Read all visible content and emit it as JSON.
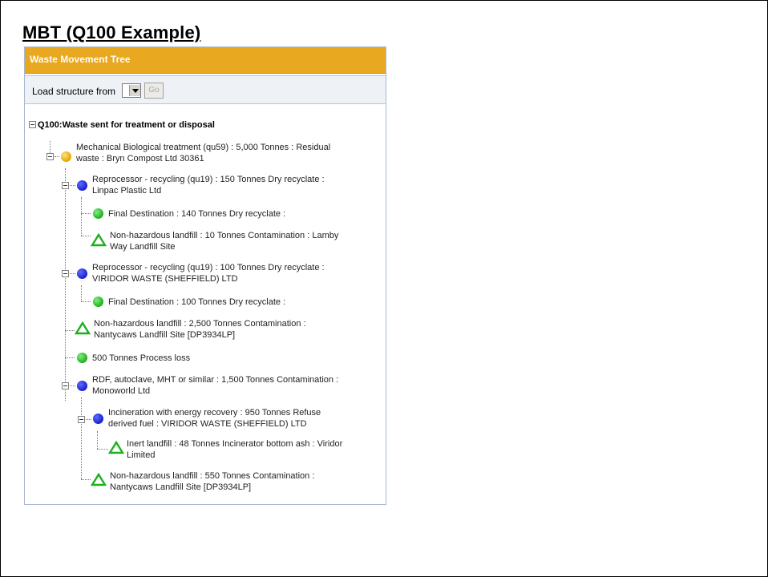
{
  "page": {
    "title": "MBT (Q100 Example)"
  },
  "panel": {
    "header": "Waste Movement Tree",
    "toolbar": {
      "load_label": "Load structure from",
      "go_label": "Go"
    }
  },
  "tree": {
    "root": "Q100:Waste sent for treatment or disposal",
    "nodes": [
      {
        "icon": "orange-circle",
        "line1": "Mechanical Biological treatment (qu59) : 5,000 Tonnes : Residual",
        "line2": "waste : Bryn Compost Ltd 30361"
      },
      {
        "icon": "blue-circle",
        "line1": "Reprocessor - recycling (qu19) : 150 Tonnes Dry recyclate :",
        "line2": "Linpac Plastic Ltd"
      },
      {
        "icon": "green-circle",
        "line1": "Final Destination : 140 Tonnes Dry recyclate :",
        "line2": ""
      },
      {
        "icon": "green-triangle",
        "line1": "Non-hazardous landfill : 10 Tonnes Contamination : Lamby",
        "line2": "Way Landfill Site"
      },
      {
        "icon": "blue-circle",
        "line1": "Reprocessor - recycling (qu19) : 100 Tonnes Dry recyclate :",
        "line2": "VIRIDOR WASTE (SHEFFIELD) LTD"
      },
      {
        "icon": "green-circle",
        "line1": "Final Destination : 100 Tonnes Dry recyclate :",
        "line2": ""
      },
      {
        "icon": "green-triangle",
        "line1": "Non-hazardous landfill : 2,500 Tonnes Contamination :",
        "line2": "Nantycaws Landfill Site [DP3934LP]"
      },
      {
        "icon": "green-circle",
        "line1": "500 Tonnes Process loss",
        "line2": ""
      },
      {
        "icon": "blue-circle",
        "line1": "RDF, autoclave, MHT or similar : 1,500 Tonnes Contamination :",
        "line2": "Monoworld Ltd"
      },
      {
        "icon": "blue-circle",
        "line1": "Incineration with energy recovery : 950 Tonnes Refuse",
        "line2": "derived fuel : VIRIDOR WASTE (SHEFFIELD) LTD"
      },
      {
        "icon": "green-triangle",
        "line1": "Inert landfill : 48 Tonnes Incinerator bottom ash : Viridor",
        "line2": "Limited"
      },
      {
        "icon": "green-triangle",
        "line1": "Non-hazardous landfill : 550 Tonnes Contamination :",
        "line2": "Nantycaws Landfill Site [DP3934LP]"
      }
    ]
  },
  "colors": {
    "header_bg": "#e8a820",
    "panel_border": "#a9b8d0",
    "toolbar_bg": "#eef1f6",
    "orange_node": "#e2a400",
    "blue_node": "#1a1fcf",
    "green_node": "#1fae1f"
  }
}
